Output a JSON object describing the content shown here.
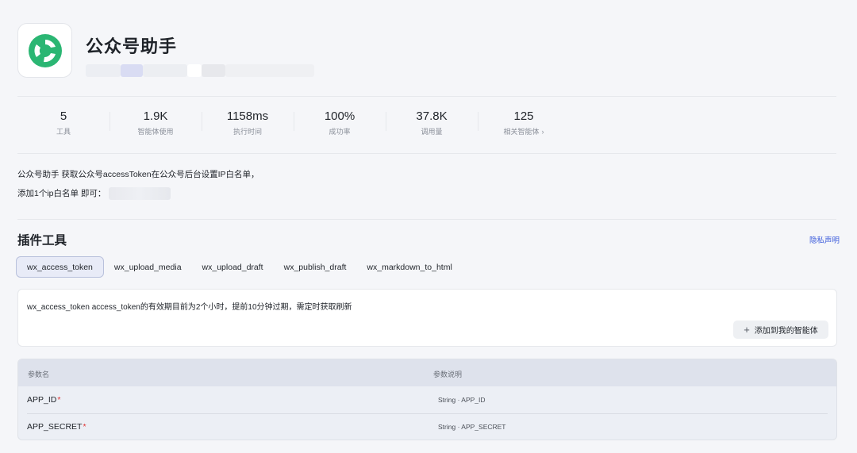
{
  "plugin": {
    "name": "公众号助手",
    "icon": "wechat-official-account-logo",
    "brand_color": "#2bb673"
  },
  "stats": [
    {
      "value": "5",
      "label": "工具"
    },
    {
      "value": "1.9K",
      "label": "智能体使用"
    },
    {
      "value": "1158ms",
      "label": "执行时间"
    },
    {
      "value": "100%",
      "label": "成功率"
    },
    {
      "value": "37.8K",
      "label": "调用量"
    },
    {
      "value": "125",
      "label": "相关智能体",
      "chevron": "›"
    }
  ],
  "description": {
    "line1": "公众号助手 获取公众号accessToken在公众号后台设置IP白名单，",
    "line2": "添加1个ip白名单 即可："
  },
  "section": {
    "title": "插件工具",
    "privacy_link": "隐私声明"
  },
  "tabs": [
    {
      "label": "wx_access_token",
      "active": true
    },
    {
      "label": "wx_upload_media",
      "active": false
    },
    {
      "label": "wx_upload_draft",
      "active": false
    },
    {
      "label": "wx_publish_draft",
      "active": false
    },
    {
      "label": "wx_markdown_to_html",
      "active": false
    }
  ],
  "tool": {
    "description": "wx_access_token access_token的有效期目前为2个小时，提前10分钟过期，需定时获取刷新",
    "add_button": "添加到我的智能体",
    "add_icon": "plus-icon"
  },
  "params_table": {
    "headers": [
      "参数名",
      "参数说明"
    ],
    "rows": [
      {
        "name": "APP_ID",
        "required_mark": "*",
        "desc": "String · APP_ID"
      },
      {
        "name": "APP_SECRET",
        "required_mark": "*",
        "desc": "String · APP_SECRET"
      }
    ]
  },
  "colors": {
    "accent": "#3b5bdb",
    "required": "#e03131",
    "logo_green": "#2bb673"
  }
}
